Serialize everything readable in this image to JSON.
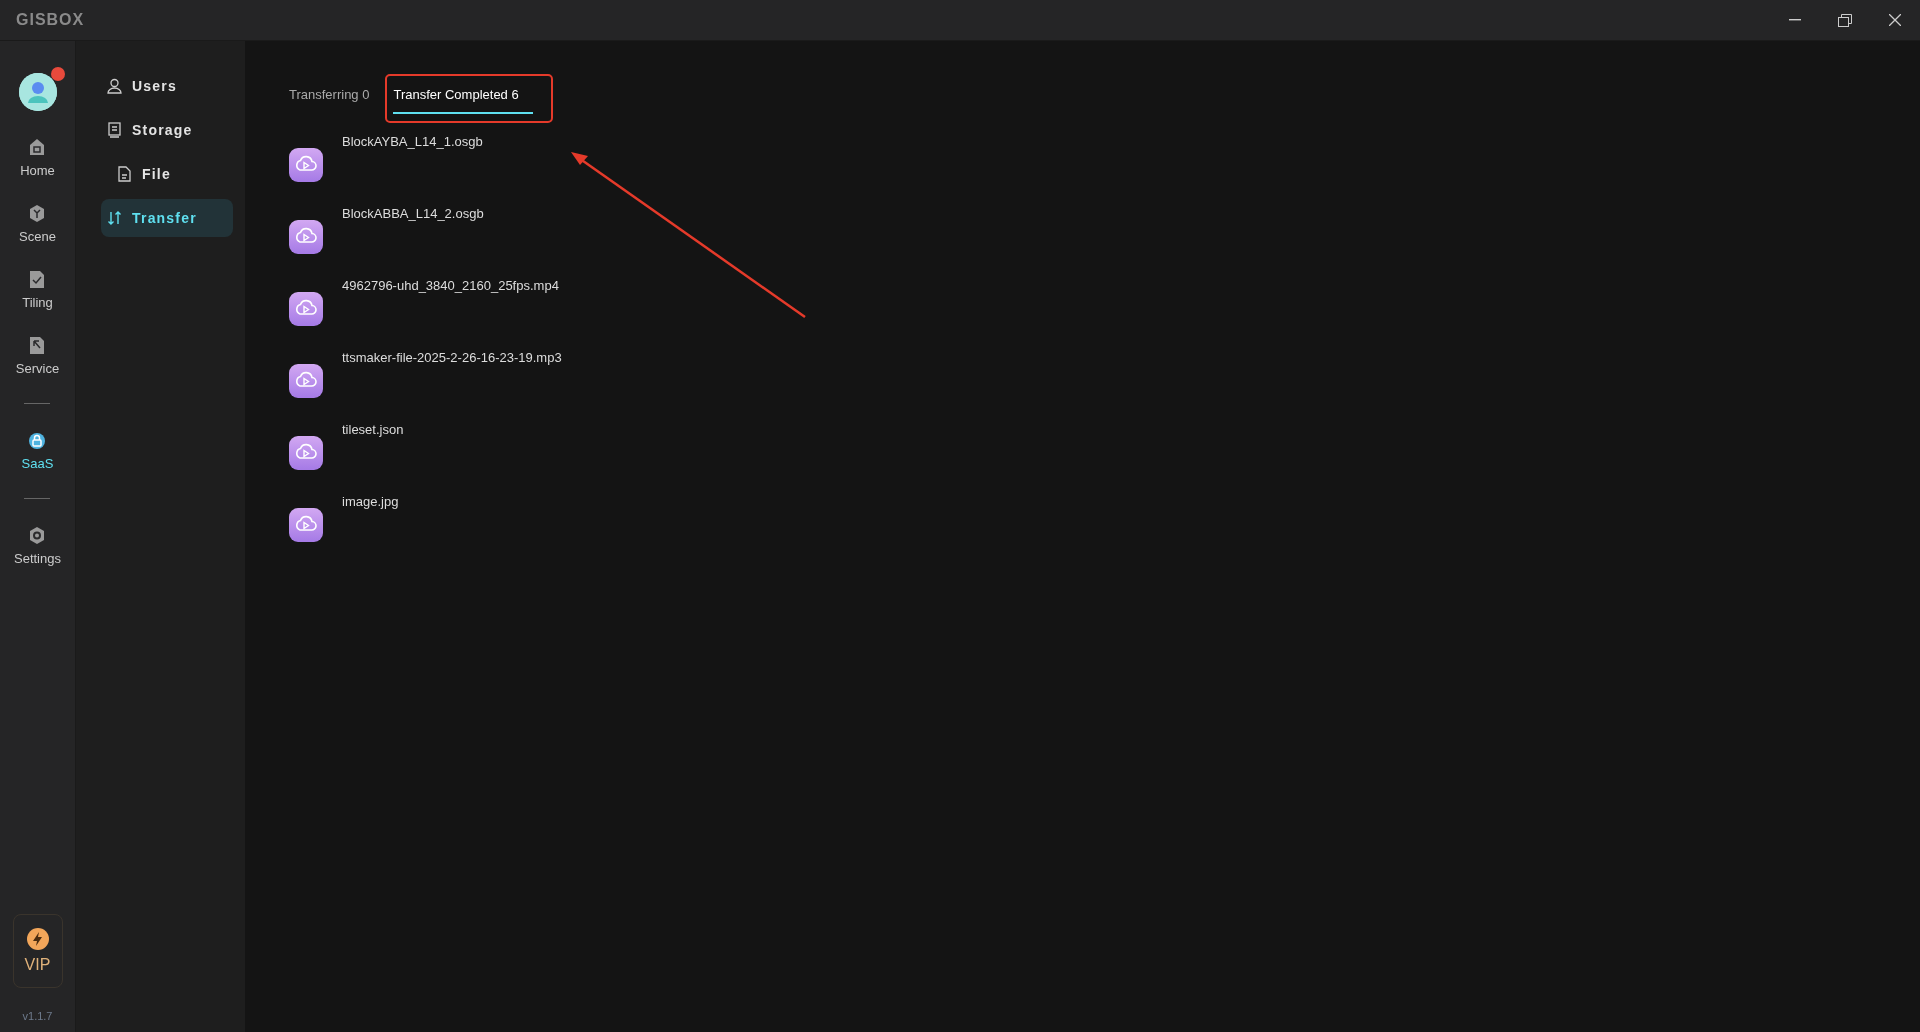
{
  "title_bar": {
    "logo": "GISBOX"
  },
  "rail": {
    "items": [
      {
        "label": "Home",
        "selected": false,
        "divider_before": false
      },
      {
        "label": "Scene",
        "selected": false,
        "divider_before": false
      },
      {
        "label": "Tiling",
        "selected": false,
        "divider_before": false
      },
      {
        "label": "Service",
        "selected": false,
        "divider_before": false
      },
      {
        "label": "SaaS",
        "selected": true,
        "divider_before": true
      },
      {
        "label": "Settings",
        "selected": false,
        "divider_before": true
      }
    ],
    "vip": "VIP",
    "version": "v1.1.7"
  },
  "sidebar": {
    "items": [
      {
        "label": "Users",
        "selected": false
      },
      {
        "label": "Storage",
        "selected": false,
        "children": [
          {
            "label": "File",
            "selected": false
          }
        ]
      },
      {
        "label": "Transfer",
        "selected": true
      }
    ]
  },
  "tabs": [
    {
      "label": "Transferring 0",
      "selected": false
    },
    {
      "label": "Transfer Completed 6",
      "selected": true
    }
  ],
  "files": [
    {
      "name": "BlockAYBA_L14_1.osgb"
    },
    {
      "name": "BlockABBA_L14_2.osgb"
    },
    {
      "name": "4962796-uhd_3840_2160_25fps.mp4"
    },
    {
      "name": "ttsmaker-file-2025-2-26-16-23-19.mp3"
    },
    {
      "name": "tileset.json"
    },
    {
      "name": "image.jpg"
    }
  ]
}
